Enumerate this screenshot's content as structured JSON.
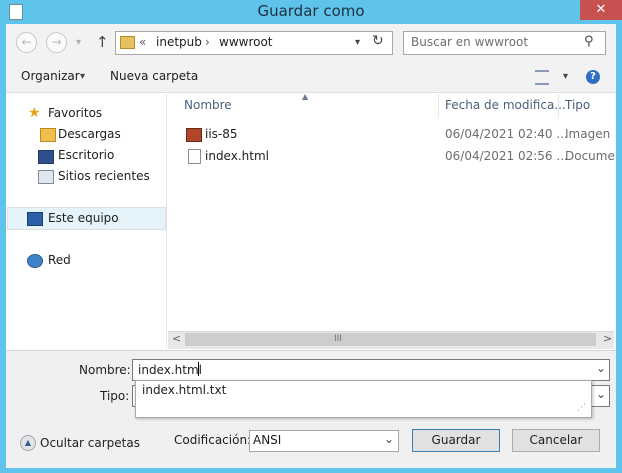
{
  "window": {
    "title": "Guardar como",
    "close_glyph": "✕"
  },
  "nav": {
    "back_glyph": "←",
    "forward_glyph": "→",
    "up_glyph": "↑",
    "history_glyph": "▾",
    "breadcrumb": {
      "overflow": "«",
      "items": [
        "inetpub",
        "wwwroot"
      ],
      "sep": "›"
    },
    "refresh_glyph": "↻",
    "search": {
      "placeholder": "Buscar en wwwroot",
      "icon_glyph": "⚲"
    }
  },
  "toolbar": {
    "organize": "Organizar",
    "new_folder": "Nueva carpeta",
    "caret": "▾",
    "help_glyph": "?"
  },
  "sidebar": {
    "favorites": "Favoritos",
    "items": [
      "Descargas",
      "Escritorio",
      "Sitios recientes"
    ],
    "this_pc": "Este equipo",
    "network": "Red"
  },
  "file_list": {
    "columns": {
      "name": "Nombre",
      "date": "Fecha de modifica...",
      "type": "Tipo",
      "sort_glyph": "▲"
    },
    "rows": [
      {
        "name": "iis-85",
        "date": "06/04/2021 02:40 ...",
        "type": "Imagen P"
      },
      {
        "name": "index.html",
        "date": "06/04/2021 02:56 ...",
        "type": "Documen"
      }
    ],
    "scroll": {
      "left": "<",
      "right": ">",
      "grip": "III"
    }
  },
  "form": {
    "name_label": "Nombre:",
    "name_value": "index.html",
    "autocomplete": [
      "index.html.txt"
    ],
    "type_label": "Tipo:",
    "encoding_label": "Codificación:",
    "encoding_value": "ANSI",
    "save": "Guardar",
    "cancel": "Cancelar",
    "hide_folders": "Ocultar carpetas",
    "dropdown_glyph": "⌄"
  },
  "colors": {
    "titlebar": "#5ec4ec",
    "close": "#c75050",
    "selection": "#e5f3fb"
  }
}
